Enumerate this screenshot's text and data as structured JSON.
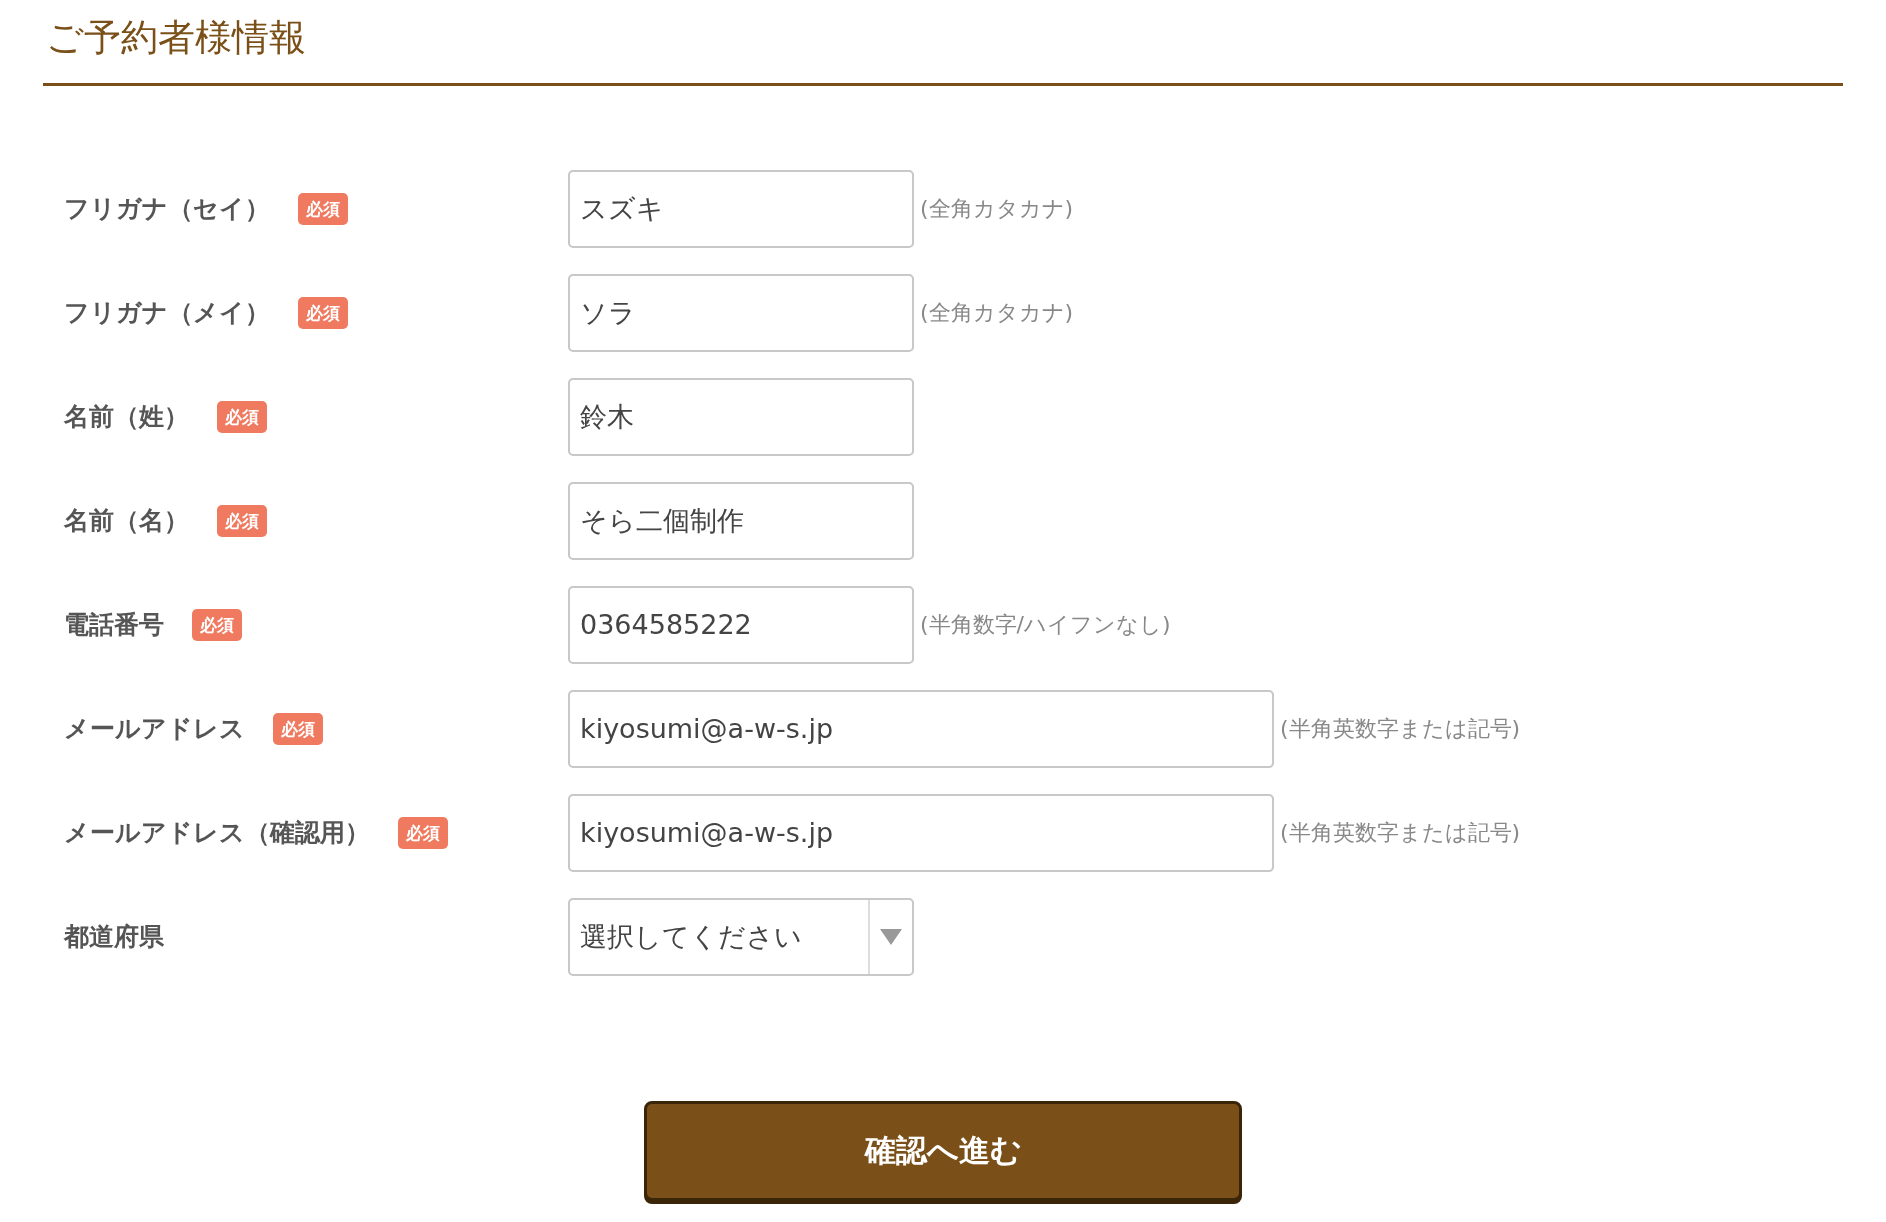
{
  "section_title": "ご予約者様情報",
  "fields": [
    {
      "kind": "text",
      "label": "フリガナ（セイ）",
      "required": true,
      "badge": "必須",
      "value": "スズキ",
      "hint": "(全角カタカナ)"
    },
    {
      "kind": "text",
      "label": "フリガナ（メイ）",
      "required": true,
      "badge": "必須",
      "value": "ソラ",
      "hint": "(全角カタカナ)"
    },
    {
      "kind": "text",
      "label": "名前（姓）",
      "required": true,
      "badge": "必須",
      "value": "鈴木"
    },
    {
      "kind": "text",
      "label": "名前（名）",
      "required": true,
      "badge": "必須",
      "value": "そら二個制作"
    },
    {
      "kind": "text",
      "label": "電話番号",
      "required": true,
      "badge": "必須",
      "value": "0364585222",
      "hint": "(半角数字/ハイフンなし)"
    },
    {
      "kind": "email",
      "label": "メールアドレス",
      "required": true,
      "badge": "必須",
      "value": "kiyosumi@a-w-s.jp",
      "hint": "(半角英数字または記号)"
    },
    {
      "kind": "email",
      "label": "メールアドレス（確認用）",
      "required": true,
      "badge": "必須",
      "value": "kiyosumi@a-w-s.jp",
      "hint": "(半角英数字または記号)"
    },
    {
      "kind": "select",
      "label": "都道府県",
      "required": false,
      "placeholder": "選択してください"
    }
  ],
  "submit_button": "確認へ進む"
}
